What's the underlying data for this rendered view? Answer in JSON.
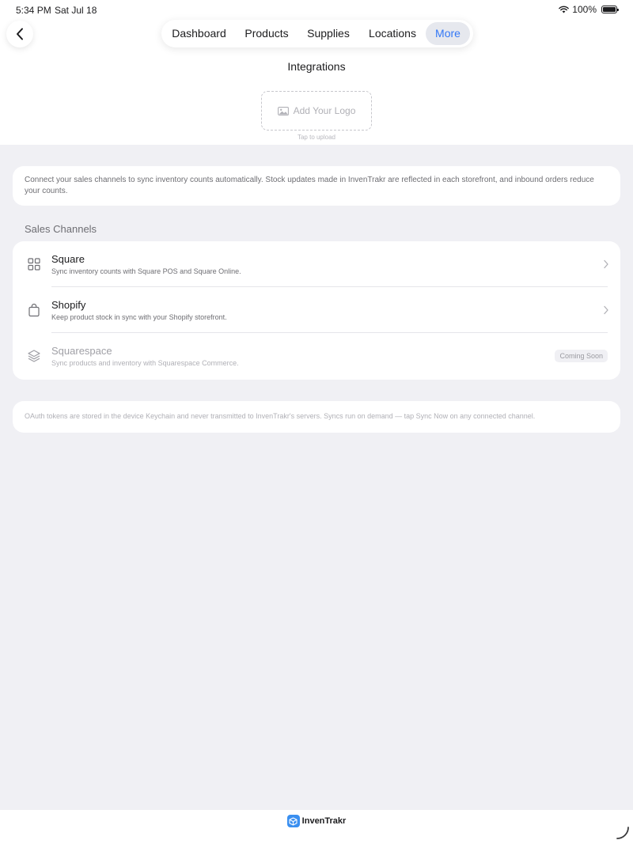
{
  "status_bar": {
    "time": "5:34 PM",
    "date": "Sat Jul 18",
    "battery": "100%"
  },
  "nav": {
    "tabs": [
      {
        "label": "Dashboard",
        "active": false
      },
      {
        "label": "Products",
        "active": false
      },
      {
        "label": "Supplies",
        "active": false
      },
      {
        "label": "Locations",
        "active": false
      },
      {
        "label": "More",
        "active": true
      }
    ]
  },
  "header": {
    "title": "Integrations",
    "logo_button": "Add Your Logo",
    "logo_hint": "Tap to upload"
  },
  "intro": {
    "text": "Connect your sales channels to sync inventory counts automatically. Stock updates made in InvenTrakr are reflected in each storefront, and inbound orders reduce your counts."
  },
  "sales_channels": {
    "header": "Sales Channels",
    "items": [
      {
        "title": "Square",
        "subtitle": "Sync inventory counts with Square POS and Square Online.",
        "icon": "grid-icon",
        "enabled": true
      },
      {
        "title": "Shopify",
        "subtitle": "Keep product stock in sync with your Shopify storefront.",
        "icon": "shopping-bag-icon",
        "enabled": true
      },
      {
        "title": "Squarespace",
        "subtitle": "Sync products and inventory with Squarespace Commerce.",
        "icon": "layers-icon",
        "enabled": false,
        "badge": "Coming Soon"
      }
    ]
  },
  "footer_note": {
    "text": "OAuth tokens are stored in the device Keychain and never transmitted to InvenTrakr's servers. Syncs run on demand — tap Sync Now on any connected channel."
  },
  "brand": {
    "name": "InvenTrakr"
  },
  "colors": {
    "accent": "#3478f6",
    "background": "#f0f0f4",
    "card": "#ffffff",
    "secondary_text": "#6e6e73"
  }
}
